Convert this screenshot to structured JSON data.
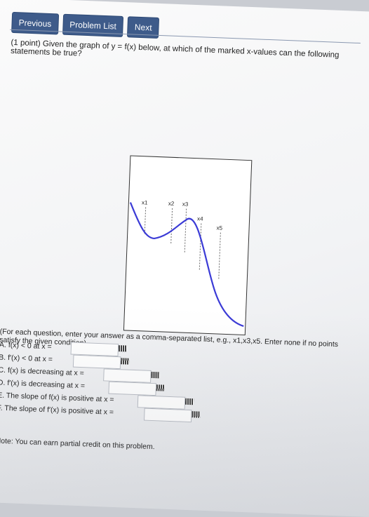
{
  "nav": {
    "previous": "Previous",
    "problem_list": "Problem List",
    "next": "Next"
  },
  "question": "(1 point) Given the graph of y = f(x) below, at which of the marked x-values can the following statements be true?",
  "graph": {
    "markers": [
      "x1",
      "x2",
      "x3",
      "x4",
      "x5"
    ],
    "curve_color": "#3b3bd6"
  },
  "instructions": "(For each question, enter your answer as a comma-separated list, e.g., x1,x3,x5. Enter none if no points satisfy the given condition)",
  "items": [
    {
      "label": "A. f(x) < 0 at x =",
      "value": ""
    },
    {
      "label": "B. f′(x) < 0 at x =",
      "value": ""
    },
    {
      "label": "C. f(x) is decreasing at x =",
      "value": ""
    },
    {
      "label": "D. f′(x) is decreasing at x =",
      "value": ""
    },
    {
      "label": "E. The slope of f(x) is positive at x =",
      "value": ""
    },
    {
      "label": "F. The slope of f′(x) is positive at x =",
      "value": ""
    }
  ],
  "note": "Note: You can earn partial credit on this problem."
}
